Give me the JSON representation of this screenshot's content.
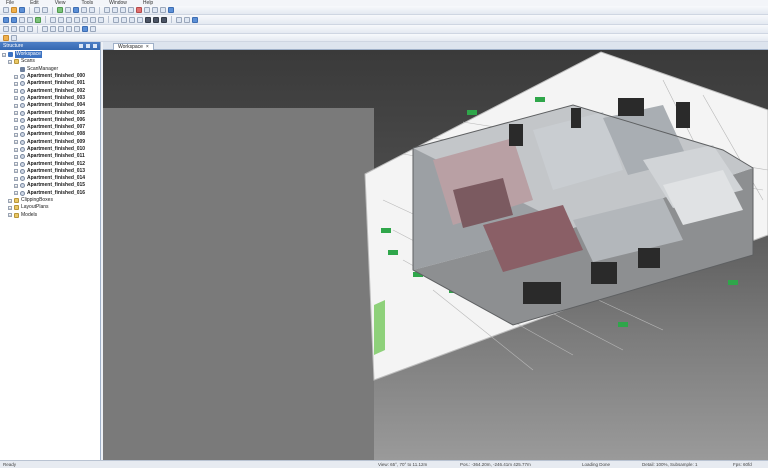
{
  "menu": [
    "File",
    "Edit",
    "View",
    "Tools",
    "Window",
    "Help"
  ],
  "panel": {
    "title": "Structure",
    "tree": [
      {
        "label": "Workspace",
        "icon": "workspace-icon",
        "level": 0,
        "selected": true,
        "bold": false
      },
      {
        "label": "Scans",
        "icon": "folder-icon",
        "level": 1,
        "selected": false,
        "bold": false
      },
      {
        "label": "ScanManager",
        "icon": "scan-manager-icon",
        "level": 2,
        "selected": false,
        "bold": false
      },
      {
        "label": "Apartment_finished_000",
        "icon": "scan-icon",
        "level": 2,
        "selected": false,
        "bold": true
      },
      {
        "label": "Apartment_finished_001",
        "icon": "scan-icon",
        "level": 2,
        "selected": false,
        "bold": true
      },
      {
        "label": "Apartment_finished_002",
        "icon": "scan-icon",
        "level": 2,
        "selected": false,
        "bold": true
      },
      {
        "label": "Apartment_finished_003",
        "icon": "scan-icon",
        "level": 2,
        "selected": false,
        "bold": true
      },
      {
        "label": "Apartment_finished_004",
        "icon": "scan-icon",
        "level": 2,
        "selected": false,
        "bold": true
      },
      {
        "label": "Apartment_finished_005",
        "icon": "scan-icon",
        "level": 2,
        "selected": false,
        "bold": true
      },
      {
        "label": "Apartment_finished_006",
        "icon": "scan-icon",
        "level": 2,
        "selected": false,
        "bold": true
      },
      {
        "label": "Apartment_finished_007",
        "icon": "scan-icon",
        "level": 2,
        "selected": false,
        "bold": true
      },
      {
        "label": "Apartment_finished_008",
        "icon": "scan-icon",
        "level": 2,
        "selected": false,
        "bold": true
      },
      {
        "label": "Apartment_finished_009",
        "icon": "scan-icon",
        "level": 2,
        "selected": false,
        "bold": true
      },
      {
        "label": "Apartment_finished_010",
        "icon": "scan-icon",
        "level": 2,
        "selected": false,
        "bold": true
      },
      {
        "label": "Apartment_finished_011",
        "icon": "scan-icon",
        "level": 2,
        "selected": false,
        "bold": true
      },
      {
        "label": "Apartment_finished_012",
        "icon": "scan-icon",
        "level": 2,
        "selected": false,
        "bold": true
      },
      {
        "label": "Apartment_finished_013",
        "icon": "scan-icon",
        "level": 2,
        "selected": false,
        "bold": true
      },
      {
        "label": "Apartment_finished_014",
        "icon": "scan-icon",
        "level": 2,
        "selected": false,
        "bold": true
      },
      {
        "label": "Apartment_finished_015",
        "icon": "scan-icon",
        "level": 2,
        "selected": false,
        "bold": true
      },
      {
        "label": "Apartment_finished_016",
        "icon": "scan-icon",
        "level": 2,
        "selected": false,
        "bold": true
      },
      {
        "label": "ClippingBoxes",
        "icon": "folder-icon",
        "level": 1,
        "selected": false,
        "bold": false
      },
      {
        "label": "LayoutPlans",
        "icon": "folder-icon",
        "level": 1,
        "selected": false,
        "bold": false
      },
      {
        "label": "Models",
        "icon": "folder-icon",
        "level": 1,
        "selected": false,
        "bold": false
      }
    ]
  },
  "workspace_tab": {
    "label": "Workspace",
    "close": "×"
  },
  "status": {
    "ready": "Ready",
    "view": "View: 65°, 70° to 11.12m",
    "pos": "Pos.: -364.20m, -246.41m 425.77m",
    "loading": "Loading Done",
    "detail": "Detail: 100%, Subsample: 1",
    "fps": "Fps: 60fd"
  },
  "colors": {
    "selection": "#3d73c2",
    "panel_header": "#3d73c2",
    "plan_label": "#2fa64a"
  }
}
